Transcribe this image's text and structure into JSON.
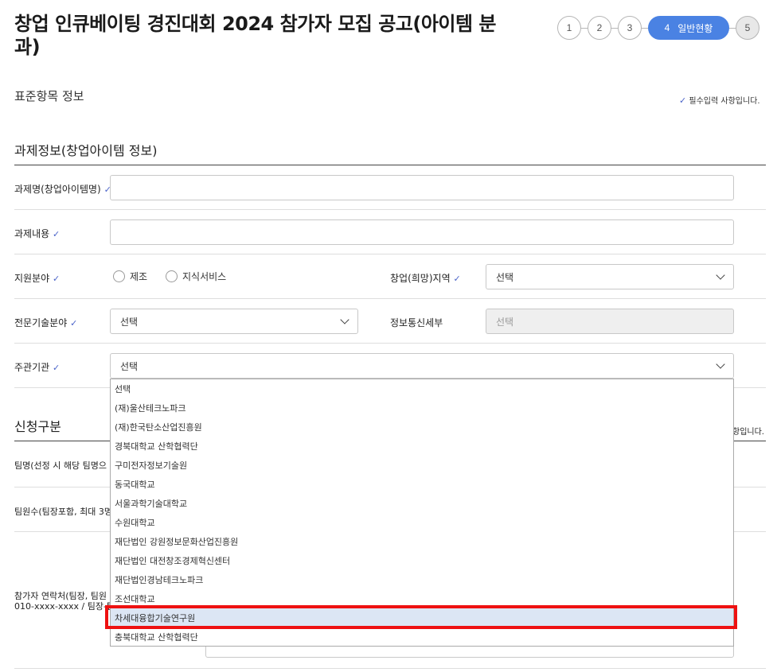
{
  "header": {
    "title": "창업 인큐베이팅 경진대회 2024 참가자 모집 공고(아이템 분과)",
    "steps": [
      "1",
      "2",
      "3",
      "4",
      "5"
    ],
    "active_step_label": "일반현황"
  },
  "sections": {
    "standard_info": "표준항목 정보",
    "required_note": "필수입력 사항입니다.",
    "project_info": "과제정보(창업아이템 정보)",
    "application_type": "신청구분",
    "required_note_2": "항입니다."
  },
  "form": {
    "project_name_label": "과제명(창업아이템명)",
    "project_content_label": "과제내용",
    "support_field_label": "지원분야",
    "support_options": [
      "제조",
      "지식서비스"
    ],
    "region_label": "창업(희망)지역",
    "region_value": "선택",
    "tech_field_label": "전문기술분야",
    "tech_field_value": "선택",
    "ict_label": "정보통신세부",
    "ict_value": "선택",
    "host_label": "주관기관",
    "host_value": "선택"
  },
  "dropdown": {
    "options": [
      "선택",
      "(재)울산테크노파크",
      "(재)한국탄소산업진흥원",
      "경북대학교 산학협력단",
      "구미전자정보기술원",
      "동국대학교",
      "서울과학기술대학교",
      "수원대학교",
      "재단법인 강원정보문화산업진흥원",
      "재단법인 대전창조경제혁신센터",
      "재단법인경남테크노파크",
      "조선대학교",
      "차세대융합기술연구원",
      "충북대학교 산학협력단"
    ],
    "highlighted_index": 12
  },
  "behind": {
    "team_name": "팀명(선정 시 해당 팀명으",
    "team_count": "팀원수(팀장포함, 최대 3명",
    "contact_line1": "참가자 연락처(팀장, 팀원",
    "contact_line2": "010-xxxx-xxxx / 팀장-팀"
  },
  "colors": {
    "accent": "#4a82e3",
    "check": "#4a63c9",
    "highlight": "#ee1111"
  }
}
